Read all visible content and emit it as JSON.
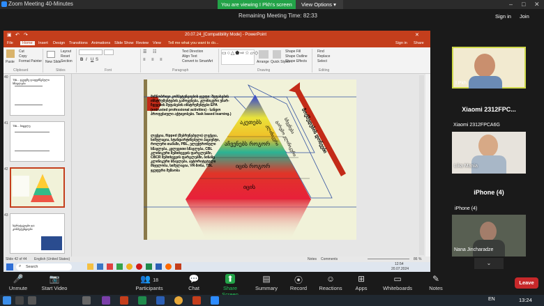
{
  "zoom": {
    "title": "Zoom Meeting 40-Minutes",
    "viewing_banner": "You are viewing I Pkh's screen",
    "view_options": "View Options",
    "remaining": "Remaining Meeting Time: 82:33",
    "sign_in": "Sign in",
    "join": "Join",
    "leave": "Leave",
    "toolbar": [
      {
        "label": "Unmute",
        "icon": "mic-muted-icon",
        "glyph": "🎤"
      },
      {
        "label": "Start Video",
        "icon": "video-off-icon",
        "glyph": "📷"
      },
      {
        "label": "Participants",
        "icon": "participants-icon",
        "glyph": "👥",
        "count": "18"
      },
      {
        "label": "Chat",
        "icon": "chat-icon",
        "glyph": "💬"
      },
      {
        "label": "Share Screen",
        "icon": "share-screen-icon",
        "glyph": "⬆"
      },
      {
        "label": "Summary",
        "icon": "summary-icon",
        "glyph": "▤"
      },
      {
        "label": "Record",
        "icon": "record-icon",
        "glyph": "⦿"
      },
      {
        "label": "Reactions",
        "icon": "reactions-icon",
        "glyph": "☺"
      },
      {
        "label": "Apps",
        "icon": "apps-icon",
        "glyph": "⊞"
      },
      {
        "label": "Whiteboards",
        "icon": "whiteboard-icon",
        "glyph": "▭"
      },
      {
        "label": "Notes",
        "icon": "notes-icon",
        "glyph": "✎"
      }
    ],
    "participants": [
      {
        "name": "I Pkh"
      },
      {
        "name": "Xiaomi 2312FPC...",
        "sub": "Xiaomi 2312FPCA6G"
      },
      {
        "name": "Lika Mania"
      },
      {
        "name": "iPhone (4)",
        "sub": "iPhone (4)"
      },
      {
        "name": "Nana Jincharadze"
      }
    ]
  },
  "ppt": {
    "title": "20.07.24_[Compatibility Mode] - PowerPoint",
    "tabs": [
      "File",
      "Home",
      "Insert",
      "Design",
      "Transitions",
      "Animations",
      "Slide Show",
      "Review",
      "View"
    ],
    "tell_me": "Tell me what you want to do...",
    "signin": "Sign in",
    "share": "Share",
    "ribbon": {
      "paste": "Paste",
      "cut": "Cut",
      "copy": "Copy",
      "format_painter": "Format Painter",
      "clipboard": "Clipboard",
      "new_slide": "New Slide",
      "layout": "Layout",
      "reset": "Reset",
      "section": "Section",
      "slides": "Slides",
      "font": "Font",
      "paragraph": "Paragraph",
      "text_direction": "Text Direction",
      "align_text": "Align Text",
      "convert_smartart": "Convert to SmartArt",
      "drawing": "Drawing",
      "arrange": "Arrange",
      "quick_styles": "Quick Styles",
      "shape_fill": "Shape Fill",
      "shape_outline": "Shape Outline",
      "shape_effects": "Shape Effects",
      "find": "Find",
      "replace": "Replace",
      "select": "Select",
      "editing": "Editing"
    },
    "thumbs": [
      {
        "num": "40",
        "title": "TBL - ჯგუფზე დაფუძნებული სწავლება"
      },
      {
        "num": "41",
        "title": "TBL - სიცვლე"
      },
      {
        "num": "42",
        "title": ""
      },
      {
        "num": "43",
        "title": "სტრატეგიები და კომპეტენციები"
      }
    ],
    "slide": {
      "left_text_1": "მიზნობრივი კომპეტენციების ჯგუფი: შეფასების ინსტრუმენტების გამოყენება, კლინიკური უნარ-ჩვევების შეფასების ინსტრუმენტები EPA (entrusted professional activities) - სანდო პროფესიული აქტივობები. Task based learning.)",
      "left_text_2": "ლექცია, flipped (შებრუნებული) ლექცია, სიმულაცია, სტანდარტიზებული პაციენტი, როლური თამაში, PBL, ელექტრონული სწავლება, კვლევითი სწავლება, CBL კლინიკური შემთხვევის ფარგლებში, CBCR შემთხვევის ფარგლებში, ბინაზე კლინიკური სწავლება, ავტორიტეტული მსჯელობა, სიმულაცია, VR-ზონა, TBL ჯგუფური მუშაობა",
      "diag_label": "მოქმედების დონეები",
      "band_1": "სჩვენება",
      "band_2": "გარემო კლინიკური",
      "band_3": "კლინიკური",
      "pyr_1": "აკეთებს",
      "pyr_2": "აჩვენებს როგორ",
      "pyr_3": "იცის როგორ",
      "pyr_4": "იცის"
    },
    "status": {
      "slide": "Slide 42 of 44",
      "lang": "English (United States)",
      "notes": "Notes",
      "comments": "Comments",
      "zoom": "86 %"
    },
    "taskbar": {
      "search": "Search",
      "time": "12:54",
      "date": "20.07.2024"
    }
  },
  "system": {
    "lang": "EN",
    "time": "13:24"
  },
  "colors": {
    "zoom_green": "#23a348",
    "ppt_red": "#c43e1c",
    "leave_red": "#c7282a"
  }
}
